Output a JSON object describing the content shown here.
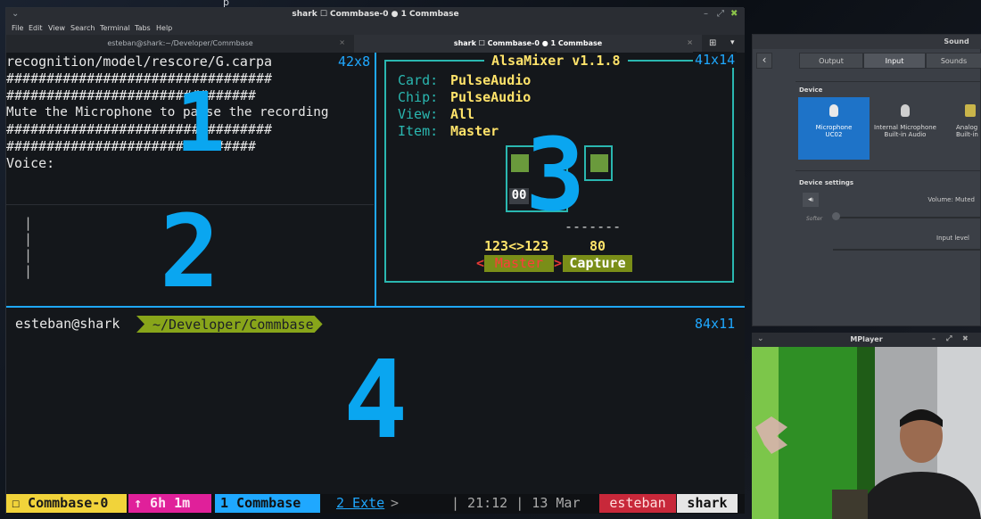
{
  "desktop": {
    "top_caption": "p"
  },
  "terminal": {
    "title": "shark ☐ Commbase-0 ● 1 Commbase",
    "menu": [
      "File",
      "Edit",
      "View",
      "Search",
      "Terminal",
      "Tabs",
      "Help"
    ],
    "tabs": [
      {
        "label": "esteban@shark:~/Developer/Commbase",
        "active": false
      },
      {
        "label": "shark ☐ Commbase-0 ● 1 Commbase",
        "active": true
      }
    ]
  },
  "pane1": {
    "lines": [
      "recognition/model/rescore/G.carpa",
      "#################################",
      "###############################",
      "Mute the Microphone to pause the recording",
      "#################################",
      "###############################",
      "Voice:"
    ],
    "size": "42x8",
    "number": "1"
  },
  "pane2": {
    "bars": [
      "|",
      "|",
      "|",
      "|"
    ],
    "number": "2"
  },
  "alsamixer": {
    "title": "AlsaMixer v1.1.8",
    "size": "41x14",
    "card_label": "Card:",
    "card": "PulseAudio",
    "chip_label": "Chip:",
    "chip": "PulseAudio",
    "view_label": "View:",
    "view": "All",
    "item_label": "Item:",
    "item": "Master",
    "level_box": "00",
    "dashes": "-------",
    "master_value": "123<>123",
    "capture_value": "80",
    "master_label": "Master",
    "capture_label": "Capture",
    "left_marker": "<",
    "right_marker": ">",
    "number": "3"
  },
  "pane4": {
    "prompt_user": "esteban@shark",
    "prompt_path": "~/Developer/Commbase",
    "size": "84x11",
    "number": "4"
  },
  "statusbar": {
    "session": "☐ Commbase-0",
    "uptime": "↑ 6h 1m",
    "window1": "1 Commbase",
    "window2": "2 Exte",
    "window2_arrow": ">",
    "time": "| 21:12 | 13 Mar",
    "user": "esteban",
    "host": "shark"
  },
  "sound": {
    "title": "Sound",
    "back": "‹",
    "tabs": [
      "Output",
      "Input",
      "Sounds"
    ],
    "active_tab": "Input",
    "device_heading": "Device",
    "devices": [
      {
        "line1": "Microphone",
        "line2": "UC02",
        "selected": true
      },
      {
        "line1": "Internal Microphone",
        "line2": "Built-in Audio",
        "selected": false
      },
      {
        "line1": "Analog",
        "line2": "Built-in",
        "selected": false
      }
    ],
    "settings_heading": "Device settings",
    "volume_label": "Volume: Muted",
    "softer_label": "Softer",
    "input_level_label": "Input level"
  },
  "mplayer": {
    "title": "MPlayer"
  },
  "colors": {
    "accent_blue": "#0aa6f0",
    "alsa_teal": "#2ab7b0",
    "alsa_yellow": "#ffe36a",
    "status_pink": "#e0209a",
    "status_yellow": "#f1d33a",
    "status_red": "#c8283a",
    "prompt_green": "#88a51a"
  }
}
